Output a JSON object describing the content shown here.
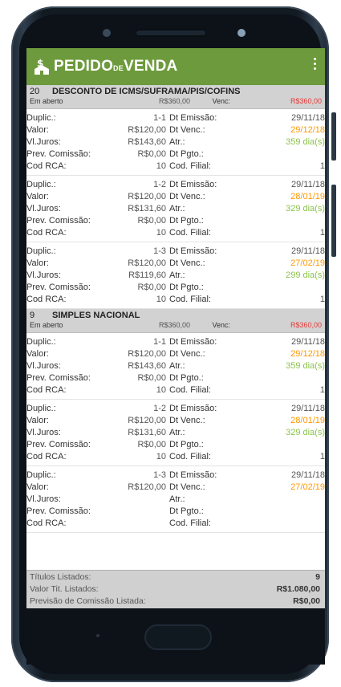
{
  "app": {
    "title_main": "PEDIDO",
    "title_de": "DE",
    "title_end": "VENDA",
    "logo_icon": "dollar-house-icon",
    "menu_icon": "more-vertical-icon",
    "accent_color": "#6d9a3c"
  },
  "groups": [
    {
      "number": "20",
      "name": "DESCONTO DE ICMS/SUFRAMA/PIS/COFINS",
      "status": "Em aberto",
      "value": "R$360,00",
      "venc_label": "Venc:",
      "venc_value": "R$360,00",
      "items": [
        {
          "duplic_label": "Duplic.:",
          "duplic": "1-1",
          "emissao_label": "Dt Emissão:",
          "emissao": "29/11/18",
          "valor_label": "Valor:",
          "valor": "R$120,00",
          "venc_label": "Dt Venc.:",
          "venc": "29/12/18",
          "juros_label": "Vl.Juros:",
          "juros": "R$143,60",
          "atr_label": "Atr.:",
          "atr": "359 dia(s)",
          "comissao_label": "Prev. Comissão:",
          "comissao": "R$0,00",
          "pgto_label": "Dt Pgto.:",
          "pgto": "",
          "rca_label": "Cod RCA:",
          "rca": "10",
          "filial_label": "Cod. Filial:",
          "filial": "1"
        },
        {
          "duplic_label": "Duplic.:",
          "duplic": "1-2",
          "emissao_label": "Dt Emissão:",
          "emissao": "29/11/18",
          "valor_label": "Valor:",
          "valor": "R$120,00",
          "venc_label": "Dt Venc.:",
          "venc": "28/01/19",
          "juros_label": "Vl.Juros:",
          "juros": "R$131,60",
          "atr_label": "Atr.:",
          "atr": "329 dia(s)",
          "comissao_label": "Prev. Comissão:",
          "comissao": "R$0,00",
          "pgto_label": "Dt Pgto.:",
          "pgto": "",
          "rca_label": "Cod RCA:",
          "rca": "10",
          "filial_label": "Cod. Filial:",
          "filial": "1"
        },
        {
          "duplic_label": "Duplic.:",
          "duplic": "1-3",
          "emissao_label": "Dt Emissão:",
          "emissao": "29/11/18",
          "valor_label": "Valor:",
          "valor": "R$120,00",
          "venc_label": "Dt Venc.:",
          "venc": "27/02/19",
          "juros_label": "Vl.Juros:",
          "juros": "R$119,60",
          "atr_label": "Atr.:",
          "atr": "299 dia(s)",
          "comissao_label": "Prev. Comissão:",
          "comissao": "R$0,00",
          "pgto_label": "Dt Pgto.:",
          "pgto": "",
          "rca_label": "Cod RCA:",
          "rca": "10",
          "filial_label": "Cod. Filial:",
          "filial": "1"
        }
      ]
    },
    {
      "number": "9",
      "name": "SIMPLES NACIONAL",
      "status": "Em aberto",
      "value": "R$360,00",
      "venc_label": "Venc:",
      "venc_value": "R$360,00",
      "items": [
        {
          "duplic_label": "Duplic.:",
          "duplic": "1-1",
          "emissao_label": "Dt Emissão:",
          "emissao": "29/11/18",
          "valor_label": "Valor:",
          "valor": "R$120,00",
          "venc_label": "Dt Venc.:",
          "venc": "29/12/18",
          "juros_label": "Vl.Juros:",
          "juros": "R$143,60",
          "atr_label": "Atr.:",
          "atr": "359 dia(s)",
          "comissao_label": "Prev. Comissão:",
          "comissao": "R$0,00",
          "pgto_label": "Dt Pgto.:",
          "pgto": "",
          "rca_label": "Cod RCA:",
          "rca": "10",
          "filial_label": "Cod. Filial:",
          "filial": "1"
        },
        {
          "duplic_label": "Duplic.:",
          "duplic": "1-2",
          "emissao_label": "Dt Emissão:",
          "emissao": "29/11/18",
          "valor_label": "Valor:",
          "valor": "R$120,00",
          "venc_label": "Dt Venc.:",
          "venc": "28/01/19",
          "juros_label": "Vl.Juros:",
          "juros": "R$131,60",
          "atr_label": "Atr.:",
          "atr": "329 dia(s)",
          "comissao_label": "Prev. Comissão:",
          "comissao": "R$0,00",
          "pgto_label": "Dt Pgto.:",
          "pgto": "",
          "rca_label": "Cod RCA:",
          "rca": "10",
          "filial_label": "Cod. Filial:",
          "filial": "1"
        },
        {
          "duplic_label": "Duplic.:",
          "duplic": "1-3",
          "emissao_label": "Dt Emissão:",
          "emissao": "29/11/18",
          "valor_label": "Valor:",
          "valor": "R$120,00",
          "venc_label": "Dt Venc.:",
          "venc": "27/02/19",
          "juros_label": "Vl.Juros:",
          "juros": "",
          "atr_label": "Atr.:",
          "atr": "",
          "comissao_label": "Prev. Comissão:",
          "comissao": "",
          "pgto_label": "Dt Pgto.:",
          "pgto": "",
          "rca_label": "Cod RCA:",
          "rca": "",
          "filial_label": "Cod. Filial:",
          "filial": ""
        }
      ]
    }
  ],
  "footer": {
    "titulos_label": "Títulos Listados:",
    "titulos_value": "9",
    "valor_label": "Valor Tit. Listados:",
    "valor_value": "R$1.080,00",
    "comissao_label": "Previsão de Comissão Listada:",
    "comissao_value": "R$0,00"
  },
  "colors": {
    "overdue_venc": "#ff9800",
    "atraso": "#8bc34a",
    "venc_total": "#e53935"
  }
}
